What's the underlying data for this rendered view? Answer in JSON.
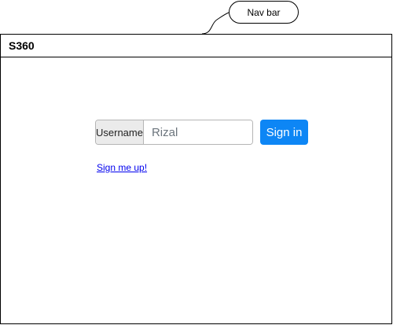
{
  "callout": {
    "label": "Nav bar"
  },
  "navbar": {
    "brand": "S360"
  },
  "login_form": {
    "username_label": "Username",
    "username_value": "Rizal",
    "signin_label": "Sign in",
    "signup_link": "Sign me up!"
  },
  "colors": {
    "primary": "#0d86f5",
    "addon_bg": "#ebebeb",
    "link": "#0000ee"
  }
}
